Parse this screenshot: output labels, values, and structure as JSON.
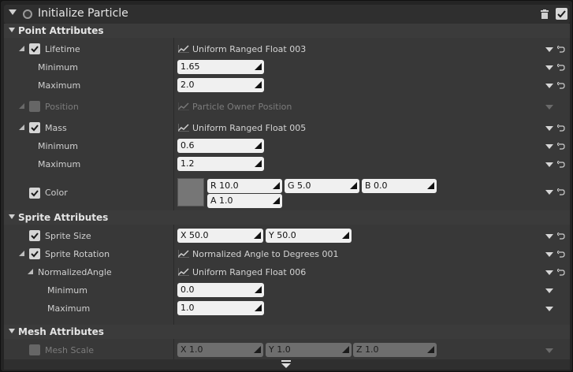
{
  "module": {
    "title": "Initialize Particle",
    "enabled": true
  },
  "categories": {
    "point": "Point Attributes",
    "sprite": "Sprite Attributes",
    "mesh": "Mesh Attributes"
  },
  "lifetime": {
    "label": "Lifetime",
    "dist": "Uniform Ranged Float 003",
    "min_label": "Minimum",
    "min": "1.65",
    "max_label": "Maximum",
    "max": "2.0"
  },
  "position": {
    "label": "Position",
    "dist": "Particle Owner Position"
  },
  "mass": {
    "label": "Mass",
    "dist": "Uniform Ranged Float 005",
    "min_label": "Minimum",
    "min": "0.6",
    "max_label": "Maximum",
    "max": "1.2"
  },
  "color": {
    "label": "Color",
    "r": "R  10.0",
    "g": "G  5.0",
    "b": "B  0.0",
    "a": "A  1.0",
    "swatch": "#767676"
  },
  "sprite_size": {
    "label": "Sprite Size",
    "x": "X  50.0",
    "y": "Y  50.0"
  },
  "sprite_rotation": {
    "label": "Sprite Rotation",
    "dist": "Normalized Angle to Degrees 001"
  },
  "normalized_angle": {
    "label": "NormalizedAngle",
    "dist": "Uniform Ranged Float 006",
    "min_label": "Minimum",
    "min": "0.0",
    "max_label": "Maximum",
    "max": "1.0"
  },
  "mesh_scale": {
    "label": "Mesh Scale",
    "x": "X  1.0",
    "y": "Y  1.0",
    "z": "Z  1.0"
  }
}
